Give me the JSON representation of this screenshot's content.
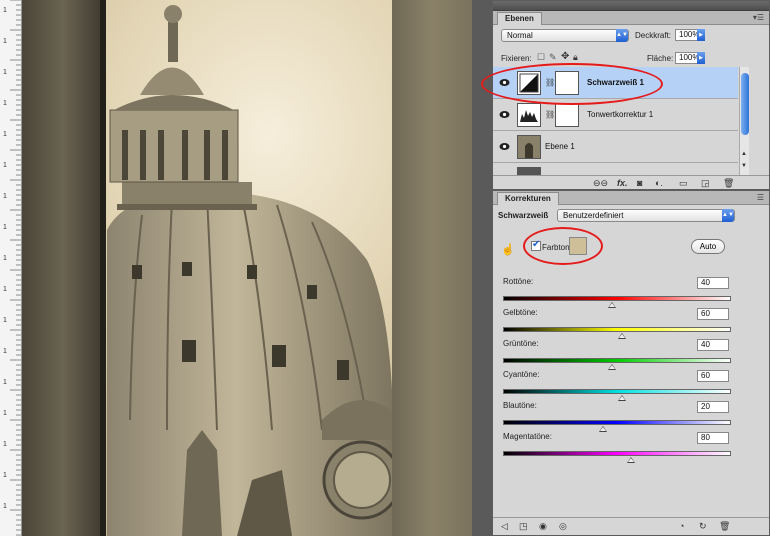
{
  "layers_panel": {
    "tab_label": "Ebenen",
    "blend_mode": "Normal",
    "opacity_label": "Deckkraft:",
    "opacity_value": "100%",
    "lock_label": "Fixieren:",
    "fill_label": "Fläche:",
    "fill_value": "100%",
    "layers": [
      {
        "name": "Schwarzweiß 1",
        "selected": true,
        "thumb_icon": "black-white-adjustment-icon"
      },
      {
        "name": "Tonwertkorrektur 1",
        "selected": false,
        "thumb_icon": "levels-histogram-icon"
      },
      {
        "name": "Ebene 1",
        "selected": false,
        "thumb_icon": "photo-thumbnail-icon"
      }
    ],
    "footer_icons": [
      "link-layers-icon",
      "fx-icon",
      "mask-icon",
      "adjustment-icon",
      "folder-icon",
      "new-layer-icon",
      "trash-icon"
    ],
    "fx_text": "fx."
  },
  "adjustments_panel": {
    "tab_label": "Korrekturen",
    "adjustment_name": "Schwarzweiß",
    "preset": "Benutzerdefiniert",
    "tint_label": "Farbton",
    "tint_checked": true,
    "tint_color": "#cfbf98",
    "auto_label": "Auto",
    "sliders": [
      {
        "label": "Rottöne:",
        "value": "40",
        "gradient": [
          "#000000",
          "#ff0000",
          "#ffffff"
        ]
      },
      {
        "label": "Gelbtöne:",
        "value": "60",
        "gradient": [
          "#000000",
          "#ffff00",
          "#ffffff"
        ]
      },
      {
        "label": "Grüntöne:",
        "value": "40",
        "gradient": [
          "#000000",
          "#00cc00",
          "#ffffff"
        ]
      },
      {
        "label": "Cyantöne:",
        "value": "60",
        "gradient": [
          "#000000",
          "#00e0e0",
          "#ffffff"
        ]
      },
      {
        "label": "Blautöne:",
        "value": "20",
        "gradient": [
          "#000000",
          "#0000ff",
          "#ffffff"
        ]
      },
      {
        "label": "Magentatöne:",
        "value": "80",
        "gradient": [
          "#000000",
          "#ff00ff",
          "#ffffff"
        ]
      }
    ],
    "footer_icons": [
      "back-icon",
      "clip-icon",
      "visibility-toggle-icon",
      "eye-icon",
      "view-previous-icon",
      "reset-icon",
      "trash-icon"
    ]
  },
  "ruler": {
    "labels": [
      "1",
      "1",
      "1",
      "1",
      "1",
      "1",
      "1",
      "1",
      "1",
      "1",
      "1",
      "1",
      "1",
      "1",
      "1",
      "1",
      "1"
    ]
  },
  "colors": {
    "selection_blue": "#b5d2f6",
    "highlight_red": "#e51b1b",
    "panel_gray": "#d6d6d6",
    "sepia_sky": "#e8dcc0"
  }
}
